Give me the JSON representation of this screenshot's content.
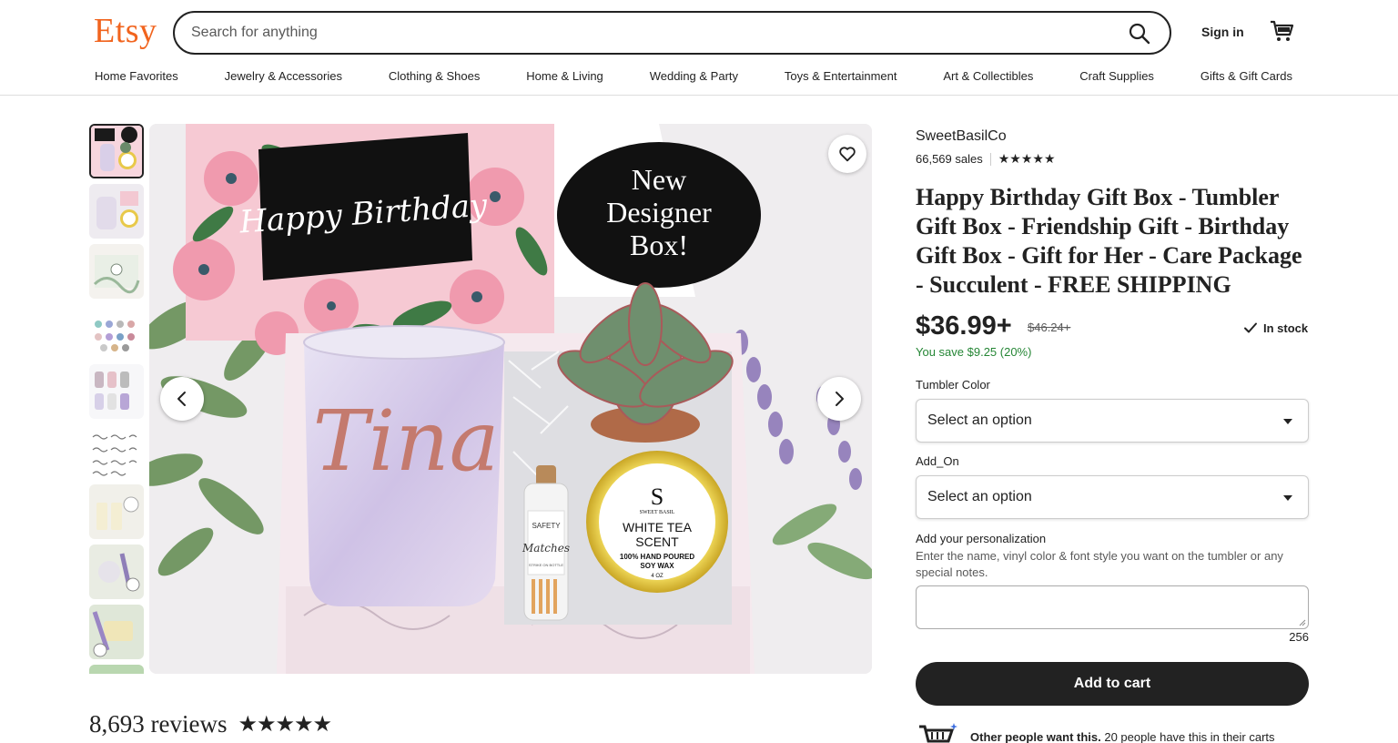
{
  "header": {
    "logo": "Etsy",
    "search_placeholder": "Search for anything",
    "sign_in": "Sign in"
  },
  "nav": [
    "Home Favorites",
    "Jewelry & Accessories",
    "Clothing & Shoes",
    "Home & Living",
    "Wedding & Party",
    "Toys & Entertainment",
    "Art & Collectibles",
    "Craft Supplies",
    "Gifts & Gift Cards"
  ],
  "gallery": {
    "thumbnail_count": 10,
    "active_index": 0,
    "image_text": {
      "card": "Happy Birthday",
      "badge_line1": "New",
      "badge_line2": "Designer",
      "badge_line3": "Box!",
      "tumbler_name": "Tina",
      "matches_label": "Matches",
      "matches_top": "SAFETY",
      "matches_bottom": "STRIKE ON BOTTLE",
      "candle_brand": "SWEET BASIL",
      "candle_logo": "S",
      "candle_line1": "WHITE TEA",
      "candle_line2": "SCENT",
      "candle_line3": "100% HAND POURED",
      "candle_line4": "SOY WAX",
      "candle_line5": "4 OZ"
    }
  },
  "reviews": {
    "count": "8,693 reviews",
    "stars": 5
  },
  "product": {
    "shop": "SweetBasilCo",
    "sales": "66,569 sales",
    "rating_stars": 5,
    "title": "Happy Birthday Gift Box - Tumbler Gift Box - Friendship Gift - Birthday Gift Box - Gift for Her - Care Package - Succulent - FREE SHIPPING",
    "price": "$36.99+",
    "original_price": "$46.24+",
    "stock": "In stock",
    "savings": "You save $9.25 (20%)",
    "options": [
      {
        "label": "Tumbler Color",
        "value": "Select an option"
      },
      {
        "label": "Add_On",
        "value": "Select an option"
      }
    ],
    "personalization": {
      "label": "Add your personalization",
      "help": "Enter the name, vinyl color & font style you want on the tumbler or any special notes.",
      "value": "",
      "chars_remaining": "256"
    },
    "add_to_cart": "Add to cart",
    "others_bold": "Other people want this.",
    "others_text": " 20 people have this in their carts"
  },
  "colors": {
    "brand": "#f1641e",
    "text": "#222222",
    "savings": "#258635",
    "button": "#222222"
  }
}
